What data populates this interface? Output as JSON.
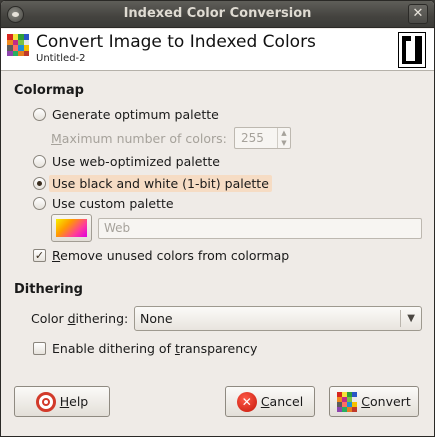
{
  "window": {
    "title": "Indexed Color Conversion",
    "close_glyph": "✕"
  },
  "header": {
    "title": "Convert Image to Indexed Colors",
    "subtitle": "Untitled-2",
    "icon": "palette-grid-icon"
  },
  "colormap": {
    "heading": "Colormap",
    "options": [
      {
        "label": "Generate optimum palette",
        "selected": false
      },
      {
        "label": "Use web-optimized palette",
        "selected": false
      },
      {
        "label": "Use black and white (1-bit) palette",
        "selected": true
      },
      {
        "label": "Use custom palette",
        "selected": false
      }
    ],
    "max_colors_label_prefix": "M",
    "max_colors_label_rest": "aximum number of colors:",
    "max_colors_value": "255",
    "custom_palette_value": "Web",
    "remove_unused_prefix": "R",
    "remove_unused_rest": "emove unused colors from colormap",
    "remove_unused_checked": true
  },
  "dithering": {
    "heading": "Dithering",
    "color_dithering_label_a": "Color ",
    "color_dithering_label_u": "d",
    "color_dithering_label_b": "ithering:",
    "color_dithering_value": "None",
    "transparency_label_a": "Enable dithering of ",
    "transparency_label_u": "t",
    "transparency_label_b": "ransparency",
    "transparency_checked": false
  },
  "buttons": {
    "help_u": "H",
    "help_rest": "elp",
    "cancel_u": "C",
    "cancel_rest": "ancel",
    "convert_u": "C",
    "convert_rest": "onvert"
  },
  "colors": {
    "accent_highlight": "#f6dcc4",
    "titlebar": "#3c3b37",
    "dialog_bg": "#efebe7"
  }
}
